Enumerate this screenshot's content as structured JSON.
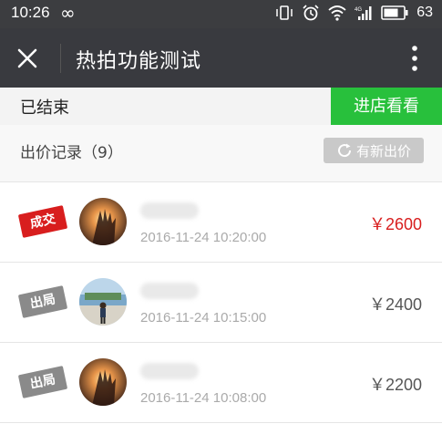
{
  "status_bar": {
    "time": "10:26",
    "loop_icon": "infinity-icon",
    "network_label": "4G",
    "battery_level": "63"
  },
  "title_bar": {
    "title": "热拍功能测试",
    "close_icon": "close-icon",
    "more_icon": "more-vertical-icon"
  },
  "info_bar": {
    "status": "已结束",
    "store_button": "进店看看"
  },
  "bid_section": {
    "title": "出价记录（9）",
    "refresh_button": "有新出价",
    "refresh_icon": "refresh-icon"
  },
  "bids": [
    {
      "stamp": "成交",
      "stamp_type": "win",
      "avatar": "sunset-hand-avatar",
      "time": "2016-11-24 10:20:00",
      "price": "￥2600"
    },
    {
      "stamp": "出局",
      "stamp_type": "lose",
      "avatar": "person-stadium-avatar",
      "time": "2016-11-24 10:15:00",
      "price": "￥2400"
    },
    {
      "stamp": "出局",
      "stamp_type": "lose",
      "avatar": "sunset-hand-avatar",
      "time": "2016-11-24 10:08:00",
      "price": "￥2200"
    }
  ],
  "colors": {
    "accent_green": "#28c03c",
    "win_red": "#d81e1e",
    "title_bar": "#393a3f"
  }
}
